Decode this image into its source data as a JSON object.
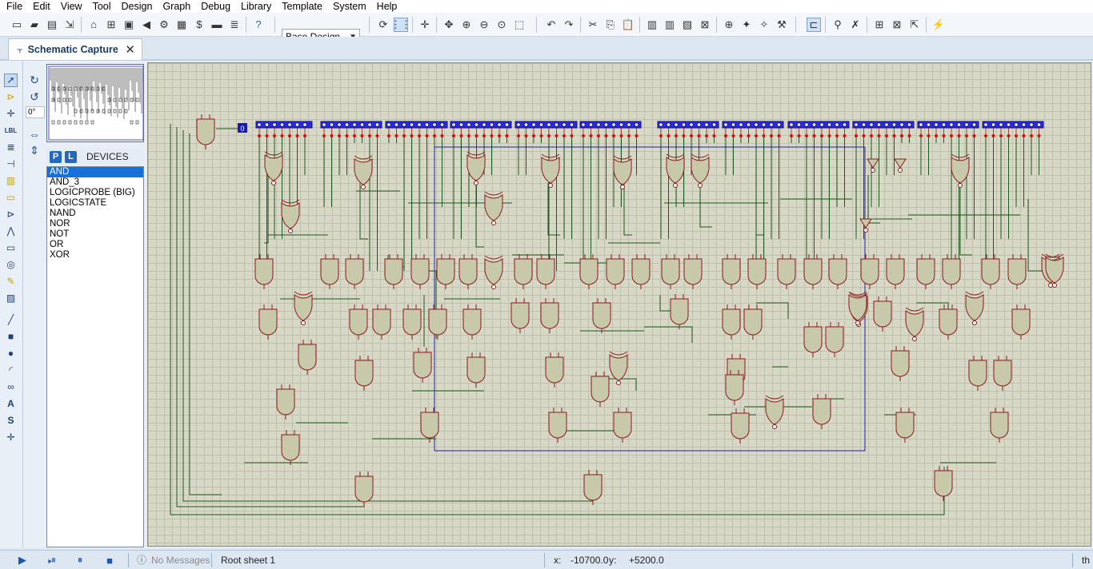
{
  "menu": [
    "File",
    "Edit",
    "View",
    "Tool",
    "Design",
    "Graph",
    "Debug",
    "Library",
    "Template",
    "System",
    "Help"
  ],
  "toolbar": {
    "design_selector": "Base Design"
  },
  "tab": {
    "title": "Schematic Capture"
  },
  "left_panel": {
    "rotation_angle": "0°",
    "picker_p": "P",
    "picker_l": "L",
    "devices_title": "DEVICES",
    "devices": [
      "AND",
      "AND_3",
      "LOGICPROBE (BIG)",
      "LOGICSTATE",
      "NAND",
      "NOR",
      "NOT",
      "OR",
      "XOR"
    ]
  },
  "canvas": {
    "probe_label": "0",
    "gate_fill": "#c8c8aa",
    "gate_stroke": "#8b1a1a",
    "wire_color": "#1d5a1d",
    "bus_color": "#2020b0"
  },
  "status": {
    "messages": "No Messages",
    "sheet": "Root sheet 1",
    "x_label": "x:",
    "x_value": "-10700.0",
    "y_label": "y:",
    "y_value": "+5200.0",
    "units": "th"
  }
}
